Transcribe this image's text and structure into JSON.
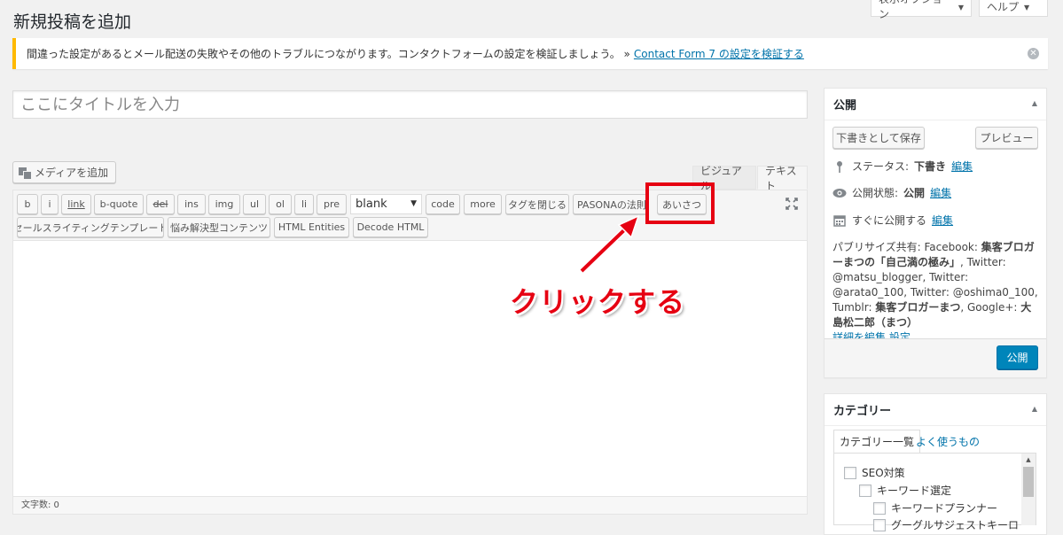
{
  "header": {
    "title": "新規投稿を追加",
    "screen_options": "表示オプション",
    "help": "ヘルプ"
  },
  "notice": {
    "text": "間違った設定があるとメール配送の失敗やその他のトラブルにつながります。コンタクトフォームの設定を検証しましょう。 »",
    "link": "Contact Form 7 の設定を検証する"
  },
  "editor": {
    "title_placeholder": "ここにタイトルを入力",
    "add_media": "メディアを追加",
    "tab_visual": "ビジュアル",
    "tab_text": "テキスト",
    "quicktags_row1": [
      "b",
      "i",
      "link",
      "b-quote",
      "del",
      "ins",
      "img",
      "ul",
      "ol",
      "li",
      "pre"
    ],
    "select_value": "blank",
    "quicktags_row1b": [
      "code",
      "more",
      "タグを閉じる",
      "PASONAの法則",
      "あいさつ"
    ],
    "quicktags_row2": [
      "セールスライティングテンプレート",
      "悩み解決型コンテンツ",
      "HTML Entities",
      "Decode HTML"
    ],
    "word_count": "文字数: 0"
  },
  "annotation": {
    "text": "クリックする",
    "color": "#e60012"
  },
  "publish": {
    "heading": "公開",
    "save_draft": "下書きとして保存",
    "preview": "プレビュー",
    "status_label": "ステータス:",
    "status_value": "下書き",
    "visibility_label": "公開状態:",
    "visibility_value": "公開",
    "schedule_label": "すぐに公開する",
    "edit": "編集",
    "publicize_prefix": "パブリサイズ共有: Facebook:",
    "publicize_fb": "集客ブロガーまつの「自己満の極み」",
    "publicize_mid": ", Twitter: @matsu_blogger, Twitter: @arata0_100, Twitter: @oshima0_100, Tumblr:",
    "publicize_tumblr": "集客ブロガーまつ",
    "publicize_gplus_label": ", Google+:",
    "publicize_gplus": "大島松二郎（まつ）",
    "publicize_edit": "詳細を編集",
    "publicize_settings": "設定",
    "publish_button": "公開"
  },
  "categories": {
    "heading": "カテゴリー",
    "tab_all": "カテゴリー一覧",
    "tab_popular": "よく使うもの",
    "items": [
      "SEO対策",
      "キーワード選定",
      "キーワードプランナー",
      "グーグルサジェストキーロ"
    ]
  },
  "colors": {
    "accent": "#0073aa",
    "primary_button": "#0085ba",
    "notice_border": "#ffb900"
  }
}
